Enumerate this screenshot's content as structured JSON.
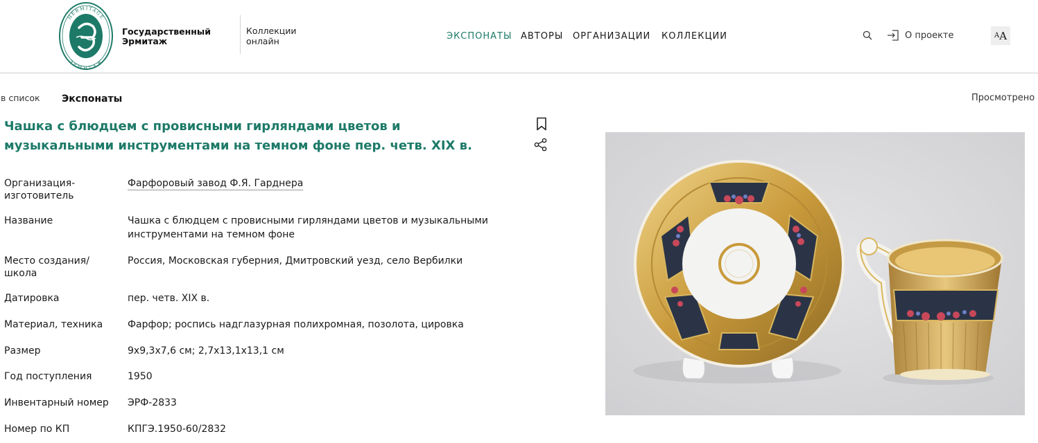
{
  "header": {
    "logo_text_top": "HERMITAGE",
    "logo_text_bottom": "ЭРМИТАЖ",
    "brand_line1": "Государственный",
    "brand_line2": "Эрмитаж",
    "collections_line1": "Коллекции",
    "collections_line2": "онлайн",
    "nav": [
      {
        "label": "ЭКСПОНАТЫ",
        "active": true
      },
      {
        "label": "АВТОРЫ",
        "active": false
      },
      {
        "label": "ОРГАНИЗАЦИИ",
        "active": false
      },
      {
        "label": "КОЛЛЕКЦИИ",
        "active": false
      }
    ],
    "about_label": "О проекте",
    "font_toggle_small": "A",
    "font_toggle_big": "A"
  },
  "breadcrumb": {
    "back_label": "в список",
    "current": "Экспонаты",
    "viewed_label": "Просмотрено"
  },
  "item": {
    "title": "Чашка с блюдцем с провисными гирляндами цветов и музыкальными инструментами на темном фоне пер. четв. XIX в.",
    "fields": [
      {
        "label": "Организация-изготовитель",
        "value": "Фарфоровый завод Ф.Я. Гарднера"
      },
      {
        "label": "Название",
        "value": "Чашка с блюдцем с провисными гирляндами цветов и музыкальными инструментами на темном фоне"
      },
      {
        "label": "Место создания/ школа",
        "value": "Россия, Московская губерния, Дмитровский уезд, село Вербилки"
      },
      {
        "label": "Датировка",
        "value": "пер. четв. XIX в."
      },
      {
        "label": "Материал, техника",
        "value": "Фарфор; роспись надглазурная полихромная, позолота, цировка"
      },
      {
        "label": "Размер",
        "value": "9x9,3x7,6 см; 2,7x13,1x13,1 см"
      },
      {
        "label": "Год поступления",
        "value": "1950"
      },
      {
        "label": "Инвентарный номер",
        "value": "ЭРФ-2833"
      },
      {
        "label": "Номер по КП",
        "value": "КПГЭ.1950-60/2832"
      }
    ]
  },
  "colors": {
    "accent": "#1d7a68",
    "text": "#1a1a1a",
    "divider": "#cfcfcf"
  },
  "icons": [
    "hermitage-logo",
    "search-icon",
    "login-icon",
    "font-size-icon",
    "bookmark-icon",
    "share-icon"
  ]
}
